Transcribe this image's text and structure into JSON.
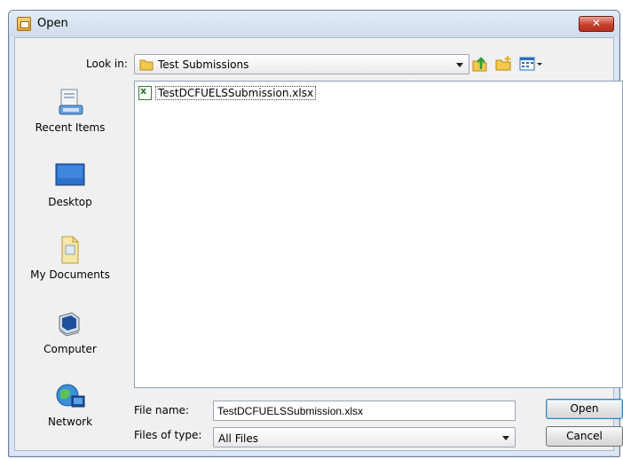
{
  "window": {
    "title": "Open",
    "close_glyph": "✕"
  },
  "lookin": {
    "label": "Look in:",
    "value": "Test Submissions"
  },
  "toolbar": {
    "up_icon": "up-one-level-icon",
    "new_folder_icon": "new-folder-icon",
    "view_menu_icon": "view-menu-icon"
  },
  "places": [
    {
      "label": "Recent Items",
      "icon": "recent-items-icon"
    },
    {
      "label": "Desktop",
      "icon": "desktop-icon"
    },
    {
      "label": "My Documents",
      "icon": "my-documents-icon"
    },
    {
      "label": "Computer",
      "icon": "computer-icon"
    },
    {
      "label": "Network",
      "icon": "network-icon"
    }
  ],
  "files": [
    {
      "name": "TestDCFUELSSubmission.xlsx",
      "icon": "excel-file-icon"
    }
  ],
  "filename": {
    "label": "File name:",
    "value": "TestDCFUELSSubmission.xlsx"
  },
  "filetype": {
    "label": "Files of type:",
    "value": "All Files"
  },
  "buttons": {
    "open": "Open",
    "cancel": "Cancel"
  }
}
